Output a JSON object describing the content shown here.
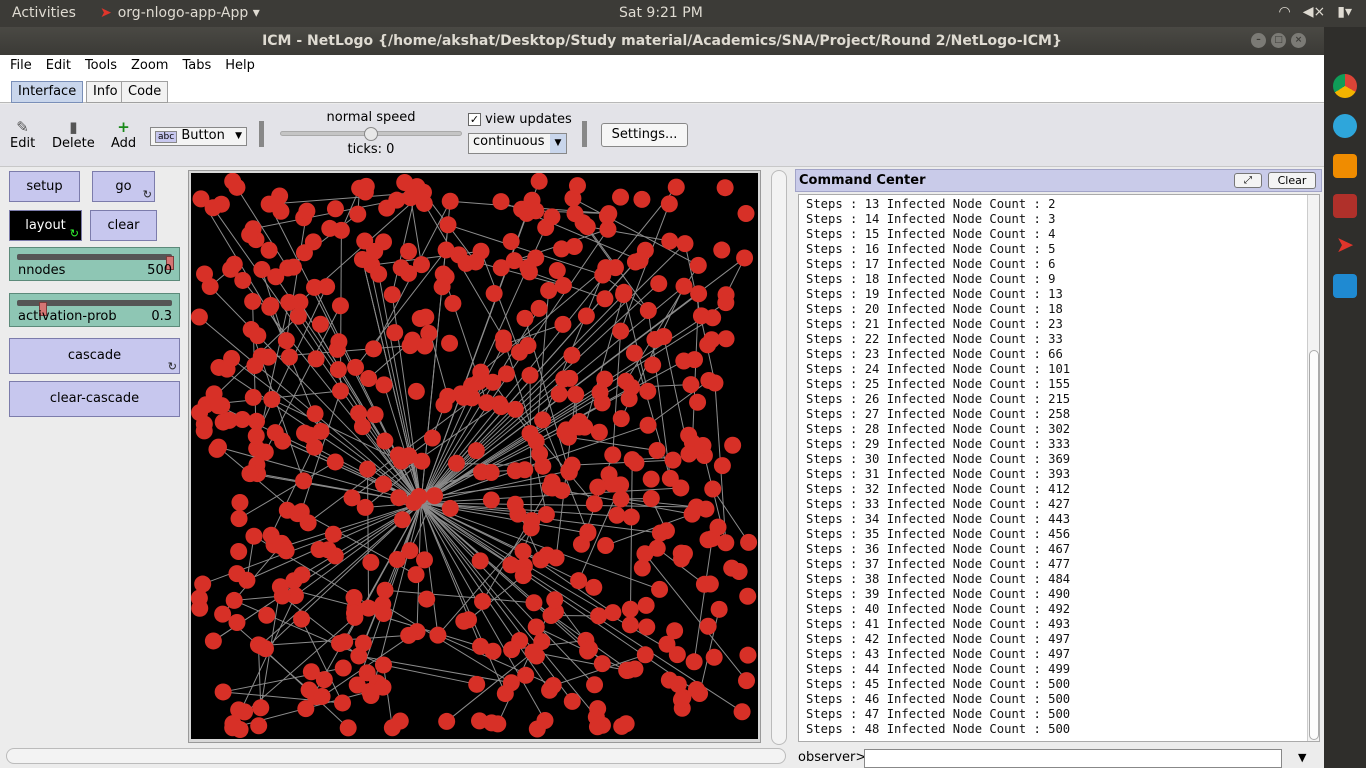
{
  "system_bar": {
    "activities": "Activities",
    "app_name": "org-nlogo-app-App ▾",
    "clock": "Sat  9:21 PM"
  },
  "window": {
    "title": "ICM - NetLogo {/home/akshat/Desktop/Study material/Academics/SNA/Project/Round 2/NetLogo-ICM}"
  },
  "menu": [
    "File",
    "Edit",
    "Tools",
    "Zoom",
    "Tabs",
    "Help"
  ],
  "tabs": [
    "Interface",
    "Info",
    "Code"
  ],
  "toolbar": {
    "edit": "Edit",
    "delete": "Delete",
    "add": "Add",
    "widget_type": "Button",
    "speed_label": "normal speed",
    "ticks": "ticks: 0",
    "view_updates_label": "view updates",
    "view_updates_checked": "✓",
    "update_mode": "continuous",
    "settings": "Settings..."
  },
  "widgets": {
    "setup": "setup",
    "go": "go",
    "layout": "layout",
    "clear": "clear",
    "nnodes": {
      "name": "nnodes",
      "value": "500",
      "fraction": 1.0
    },
    "activation_prob": {
      "name": "activation-prob",
      "value": "0.3",
      "fraction": 0.3
    },
    "cascade": "cascade",
    "clear_cascade": "clear-cascade"
  },
  "world": {
    "background": "#000000",
    "node_color": "#d73027",
    "link_color": "#8c8c8c",
    "node_count": 500
  },
  "command_center": {
    "title": "Command Center",
    "clear": "Clear",
    "lines": [
      "Steps : 13 Infected Node Count : 2",
      "Steps : 14 Infected Node Count : 3",
      "Steps : 15 Infected Node Count : 4",
      "Steps : 16 Infected Node Count : 5",
      "Steps : 17 Infected Node Count : 6",
      "Steps : 18 Infected Node Count : 9",
      "Steps : 19 Infected Node Count : 13",
      "Steps : 20 Infected Node Count : 18",
      "Steps : 21 Infected Node Count : 23",
      "Steps : 22 Infected Node Count : 33",
      "Steps : 23 Infected Node Count : 66",
      "Steps : 24 Infected Node Count : 101",
      "Steps : 25 Infected Node Count : 155",
      "Steps : 26 Infected Node Count : 215",
      "Steps : 27 Infected Node Count : 258",
      "Steps : 28 Infected Node Count : 302",
      "Steps : 29 Infected Node Count : 333",
      "Steps : 30 Infected Node Count : 369",
      "Steps : 31 Infected Node Count : 393",
      "Steps : 32 Infected Node Count : 412",
      "Steps : 33 Infected Node Count : 427",
      "Steps : 34 Infected Node Count : 443",
      "Steps : 35 Infected Node Count : 456",
      "Steps : 36 Infected Node Count : 467",
      "Steps : 37 Infected Node Count : 477",
      "Steps : 38 Infected Node Count : 484",
      "Steps : 39 Infected Node Count : 490",
      "Steps : 40 Infected Node Count : 492",
      "Steps : 41 Infected Node Count : 493",
      "Steps : 42 Infected Node Count : 497",
      "Steps : 43 Infected Node Count : 497",
      "Steps : 44 Infected Node Count : 499",
      "Steps : 45 Infected Node Count : 500",
      "Steps : 46 Infected Node Count : 500",
      "Steps : 47 Infected Node Count : 500",
      "Steps : 48 Infected Node Count : 500"
    ],
    "observer_label": "observer>"
  },
  "dock_icons": [
    "chrome-icon",
    "telegram-icon",
    "vlc-icon",
    "terminal-icon",
    "netlogo-icon",
    "vscode-icon"
  ]
}
